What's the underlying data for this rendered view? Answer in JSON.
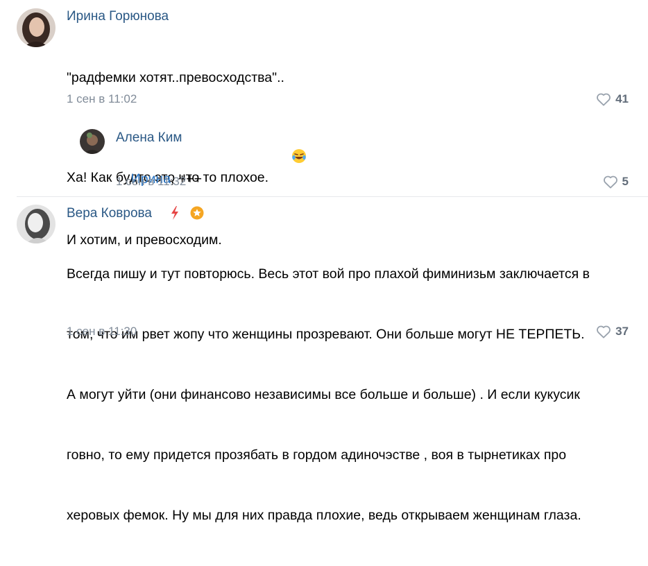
{
  "comments": [
    {
      "author": "Ирина Горюнова",
      "lines": [
        "\"радфемки хотят..превосходства\"..",
        "Ха! Как будто это что то плохое.",
        "И хотим, и превосходим."
      ],
      "emoji": "😂",
      "timestamp": "1 сен в 11:02",
      "likes": "41"
    },
    {
      "author": "Алена Ким",
      "reply_to": "Ирина",
      "text_after": ", +++",
      "timestamp": "1 сен в 11:32",
      "likes": "5"
    },
    {
      "author": "Вера Коврова",
      "lines": [
        "Всегда пишу и тут повторюсь. Весь этот вой про плахой фиминизьм заключается в",
        "том, что им рвет жопу что женщины прозревают. Они больше могут НЕ ТЕРПЕТЬ.",
        "А могут уйти (они финансово независимы все больше и больше) . И если кукусик",
        "говно, то ему придется прозябать в гордом адиночэстве , воя в тырнетиках про",
        "херовых фемок. Ну мы для них правда плохие, ведь открываем женщинам глаза."
      ],
      "timestamp": "1 сен в 11:30",
      "likes": "37"
    }
  ],
  "icons": {
    "like": "heart-outline-icon",
    "lightning": "lightning-icon",
    "star_badge": "star-badge-icon"
  },
  "colors": {
    "author": "#2a5885",
    "meta": "#818c99",
    "badge": "#f5a623",
    "lightning": "#e64646"
  }
}
